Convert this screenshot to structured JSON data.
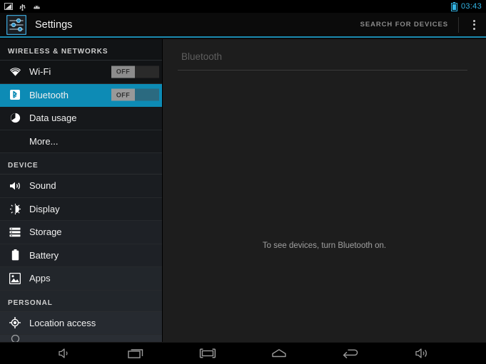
{
  "status_bar": {
    "icons": [
      "screenshot-icon",
      "usb-icon",
      "debug-icon"
    ],
    "battery_icon": "battery-icon",
    "clock": "03:43",
    "accent_color": "#33b5e5"
  },
  "action_bar": {
    "app_icon": "settings-sliders-icon",
    "title": "Settings",
    "search_label": "SEARCH FOR DEVICES",
    "overflow_icon": "overflow-menu-icon",
    "underline_color": "#1b8ab0"
  },
  "sidebar": {
    "sections": [
      {
        "header": "WIRELESS & NETWORKS",
        "items": [
          {
            "label": "Wi-Fi",
            "icon": "wifi-icon",
            "toggle": "OFF",
            "selected": false
          },
          {
            "label": "Bluetooth",
            "icon": "bluetooth-icon",
            "toggle": "OFF",
            "selected": true
          },
          {
            "label": "Data usage",
            "icon": "data-usage-icon",
            "toggle": null,
            "selected": false
          },
          {
            "label": "More...",
            "icon": null,
            "toggle": null,
            "selected": false
          }
        ]
      },
      {
        "header": "DEVICE",
        "items": [
          {
            "label": "Sound",
            "icon": "sound-icon",
            "toggle": null,
            "selected": false
          },
          {
            "label": "Display",
            "icon": "display-icon",
            "toggle": null,
            "selected": false
          },
          {
            "label": "Storage",
            "icon": "storage-icon",
            "toggle": null,
            "selected": false
          },
          {
            "label": "Battery",
            "icon": "battery-sidebar-icon",
            "toggle": null,
            "selected": false
          },
          {
            "label": "Apps",
            "icon": "apps-icon",
            "toggle": null,
            "selected": false
          }
        ]
      },
      {
        "header": "PERSONAL",
        "items": [
          {
            "label": "Location access",
            "icon": "location-icon",
            "toggle": null,
            "selected": false
          }
        ]
      }
    ],
    "selected_color": "#0d8bb5"
  },
  "main": {
    "header": "Bluetooth",
    "empty_message": "To see devices, turn Bluetooth on."
  },
  "nav_bar": {
    "buttons": [
      {
        "name": "volume-down-icon",
        "label": "volume down"
      },
      {
        "name": "recents-icon",
        "label": "recent apps"
      },
      {
        "name": "screenshot-nav-icon",
        "label": "screenshot"
      },
      {
        "name": "home-icon",
        "label": "home"
      },
      {
        "name": "back-icon",
        "label": "back"
      },
      {
        "name": "volume-up-icon",
        "label": "volume up"
      }
    ]
  }
}
